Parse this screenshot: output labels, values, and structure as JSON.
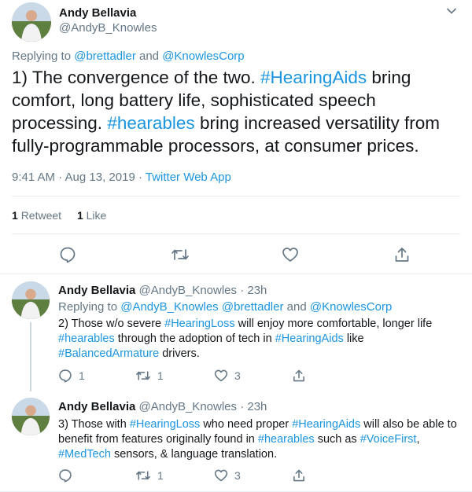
{
  "main_tweet": {
    "author_name": "Andy Bellavia",
    "author_handle": "@AndyB_Knowles",
    "replying_prefix": "Replying to",
    "reply_user_1": "@brettadler",
    "reply_and": "and",
    "reply_user_2": "@KnowlesCorp",
    "text_1": "1) The convergence of the two.",
    "hashtag_1": "#HearingAids",
    "text_2": "bring comfort, long battery life, sophisticated speech processing.",
    "hashtag_2": "#hearables",
    "text_3": "bring increased versatility from fully-programmable processors, at consumer prices.",
    "timestamp": "9:41 AM · Aug 13, 2019 ·",
    "source": "Twitter Web App",
    "retweet_count": "1",
    "retweet_label": "Retweet",
    "like_count": "1",
    "like_label": "Like"
  },
  "replies": [
    {
      "author_name": "Andy Bellavia",
      "author_handle": "@AndyB_Knowles",
      "sep": "·",
      "time": "23h",
      "replying_prefix": "Replying to",
      "reply_user_1": "@AndyB_Knowles",
      "reply_user_2": "@brettadler",
      "reply_and": "and",
      "reply_user_3": "@KnowlesCorp",
      "t1": "2) Those w/o severe",
      "h1": "#HearingLoss",
      "t2": "will enjoy more comfortable, longer life",
      "h2": "#hearables",
      "t3": "through the adoption of tech in",
      "h3": "#HearingAids",
      "t4": "like",
      "h4": "#BalancedArmature",
      "t5": "drivers.",
      "reply_count": "1",
      "retweet_count": "1",
      "like_count": "3"
    },
    {
      "author_name": "Andy Bellavia",
      "author_handle": "@AndyB_Knowles",
      "sep": "·",
      "time": "23h",
      "t1": "3) Those with",
      "h1": "#HearingLoss",
      "t2": "who need proper",
      "h2": "#HearingAids",
      "t3": "will also be able to benefit from features originally found in",
      "h3": "#hearables",
      "t4": "such as",
      "h4": "#VoiceFirst",
      "t5": ",",
      "h5": "#MedTech",
      "t6": "sensors, & language translation.",
      "reply_count": "",
      "retweet_count": "1",
      "like_count": "3"
    }
  ],
  "icons": {
    "reply": "speech-bubble-icon",
    "retweet": "retweet-arrows-icon",
    "like": "heart-icon",
    "share": "share-icon",
    "menu": "chevron-down-icon"
  },
  "colors": {
    "link": "#1b95e0",
    "secondary_text": "#657786",
    "primary_text": "#14171a",
    "divider": "#e6ecf0"
  }
}
